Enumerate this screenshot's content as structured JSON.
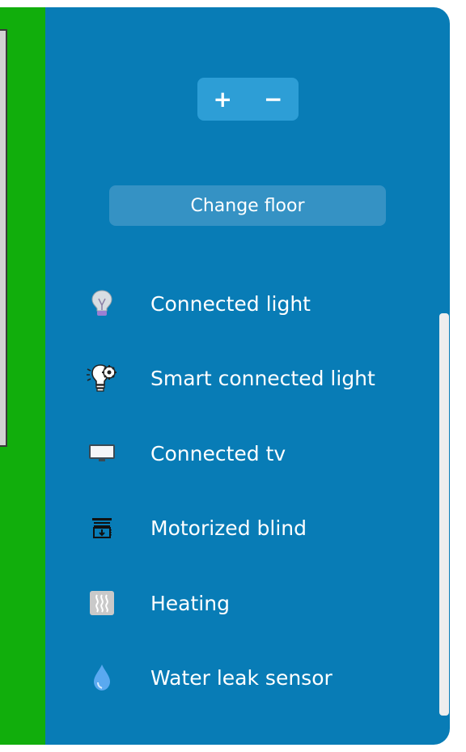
{
  "zoom": {
    "in_label": "+",
    "out_label": "−"
  },
  "floor": {
    "change_label": "Change floor"
  },
  "devices": [
    {
      "label": "Connected light",
      "icon": "light-bulb-icon"
    },
    {
      "label": "Smart connected light",
      "icon": "smart-light-gear-icon"
    },
    {
      "label": "Connected tv",
      "icon": "tv-icon"
    },
    {
      "label": "Motorized blind",
      "icon": "blind-icon"
    },
    {
      "label": "Heating",
      "icon": "heating-icon"
    },
    {
      "label": "Water leak sensor",
      "icon": "water-drop-icon"
    }
  ],
  "colors": {
    "map_background": "#11ae0c",
    "panel_background": "#087cb6",
    "zoom_group": "#2d9ed6",
    "change_floor_button": "#3592c4"
  }
}
